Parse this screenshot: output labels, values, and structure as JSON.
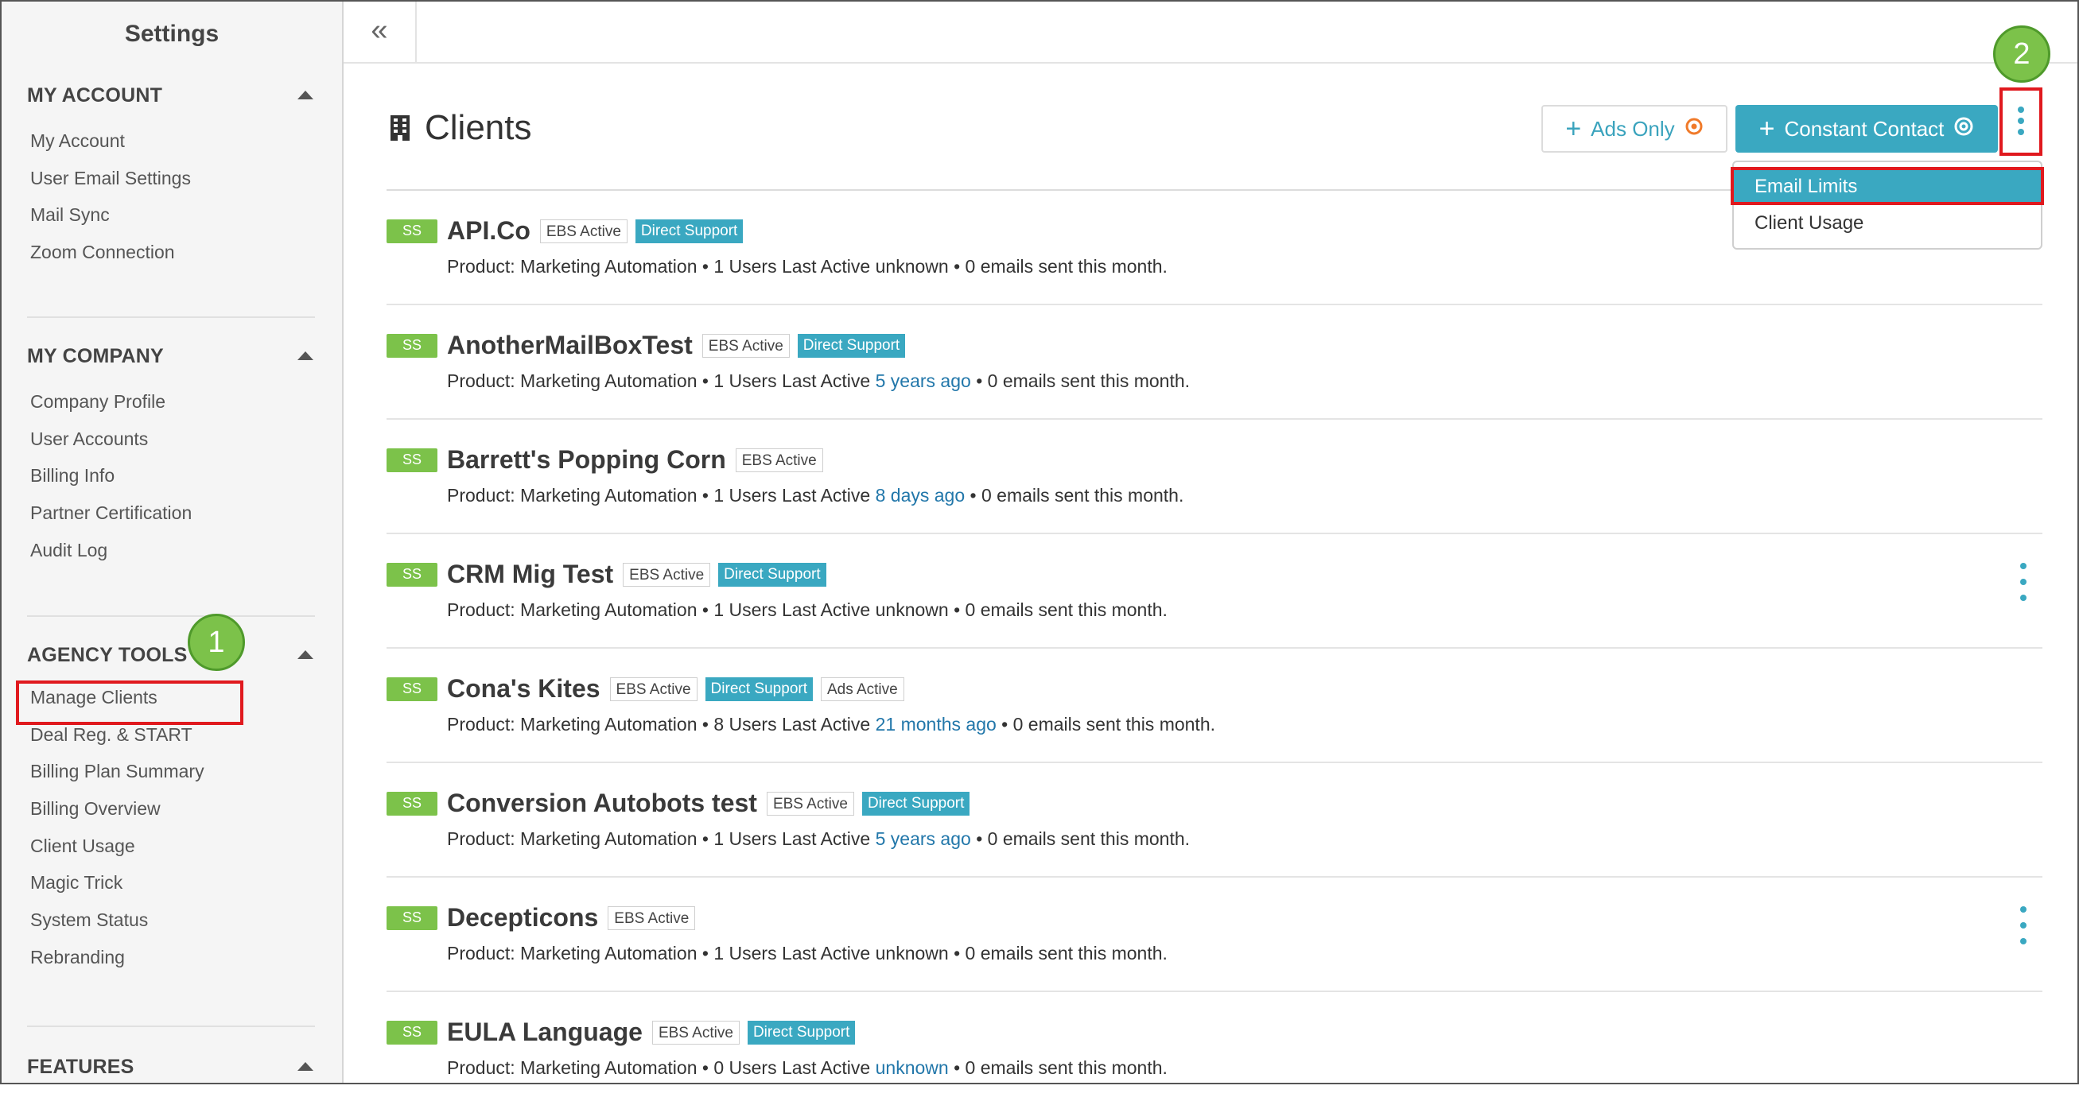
{
  "sidebar": {
    "title": "Settings",
    "sections": [
      {
        "label": "MY ACCOUNT",
        "items": [
          "My Account",
          "User Email Settings",
          "Mail Sync",
          "Zoom Connection"
        ]
      },
      {
        "label": "MY COMPANY",
        "items": [
          "Company Profile",
          "User Accounts",
          "Billing Info",
          "Partner Certification",
          "Audit Log"
        ]
      },
      {
        "label": "AGENCY TOOLS",
        "items": [
          "Manage Clients",
          "Deal Reg. & START",
          "Billing Plan Summary",
          "Billing Overview",
          "Client Usage",
          "Magic Trick",
          "System Status",
          "Rebranding"
        ]
      },
      {
        "label": "FEATURES",
        "items": []
      }
    ]
  },
  "topbar": {
    "collapse_icon": "«"
  },
  "main": {
    "title": "Clients",
    "ads_only_label": "Ads Only",
    "constant_contact_label": "Constant Contact",
    "dropdown": [
      "Email Limits",
      "Client Usage"
    ],
    "callouts": [
      "1",
      "2"
    ],
    "product_prefix": "Product: Marketing Automation • ",
    "users_suffix": " Users Last Active ",
    "emails_suffix": " • 0 emails sent this month.",
    "ss_label": "SS",
    "clients": [
      {
        "name": "API.Co",
        "tags": [
          "EBS Active",
          "Direct Support"
        ],
        "users": "1",
        "last_active": "unknown",
        "last_active_link": false,
        "kebab": false
      },
      {
        "name": "AnotherMailBoxTest",
        "tags": [
          "EBS Active",
          "Direct Support"
        ],
        "users": "1",
        "last_active": "5 years ago",
        "last_active_link": true,
        "kebab": false
      },
      {
        "name": "Barrett's Popping Corn",
        "tags": [
          "EBS Active"
        ],
        "users": "1",
        "last_active": "8 days ago",
        "last_active_link": true,
        "kebab": false
      },
      {
        "name": "CRM Mig Test",
        "tags": [
          "EBS Active",
          "Direct Support"
        ],
        "users": "1",
        "last_active": "unknown",
        "last_active_link": false,
        "kebab": true
      },
      {
        "name": "Cona's Kites",
        "tags": [
          "EBS Active",
          "Direct Support",
          "Ads Active"
        ],
        "users": "8",
        "last_active": "21 months ago",
        "last_active_link": true,
        "kebab": false
      },
      {
        "name": "Conversion Autobots test",
        "tags": [
          "EBS Active",
          "Direct Support"
        ],
        "users": "1",
        "last_active": "5 years ago",
        "last_active_link": true,
        "kebab": false
      },
      {
        "name": "Decepticons",
        "tags": [
          "EBS Active"
        ],
        "users": "1",
        "last_active": "unknown",
        "last_active_link": false,
        "kebab": true
      },
      {
        "name": "EULA Language",
        "tags": [
          "EBS Active",
          "Direct Support"
        ],
        "users": "0",
        "last_active": "unknown",
        "last_active_link": true,
        "kebab": false
      }
    ]
  },
  "colors": {
    "accent": "#3aa8c1",
    "ss_green": "#7cc24a",
    "highlight_red": "#e0191e"
  }
}
